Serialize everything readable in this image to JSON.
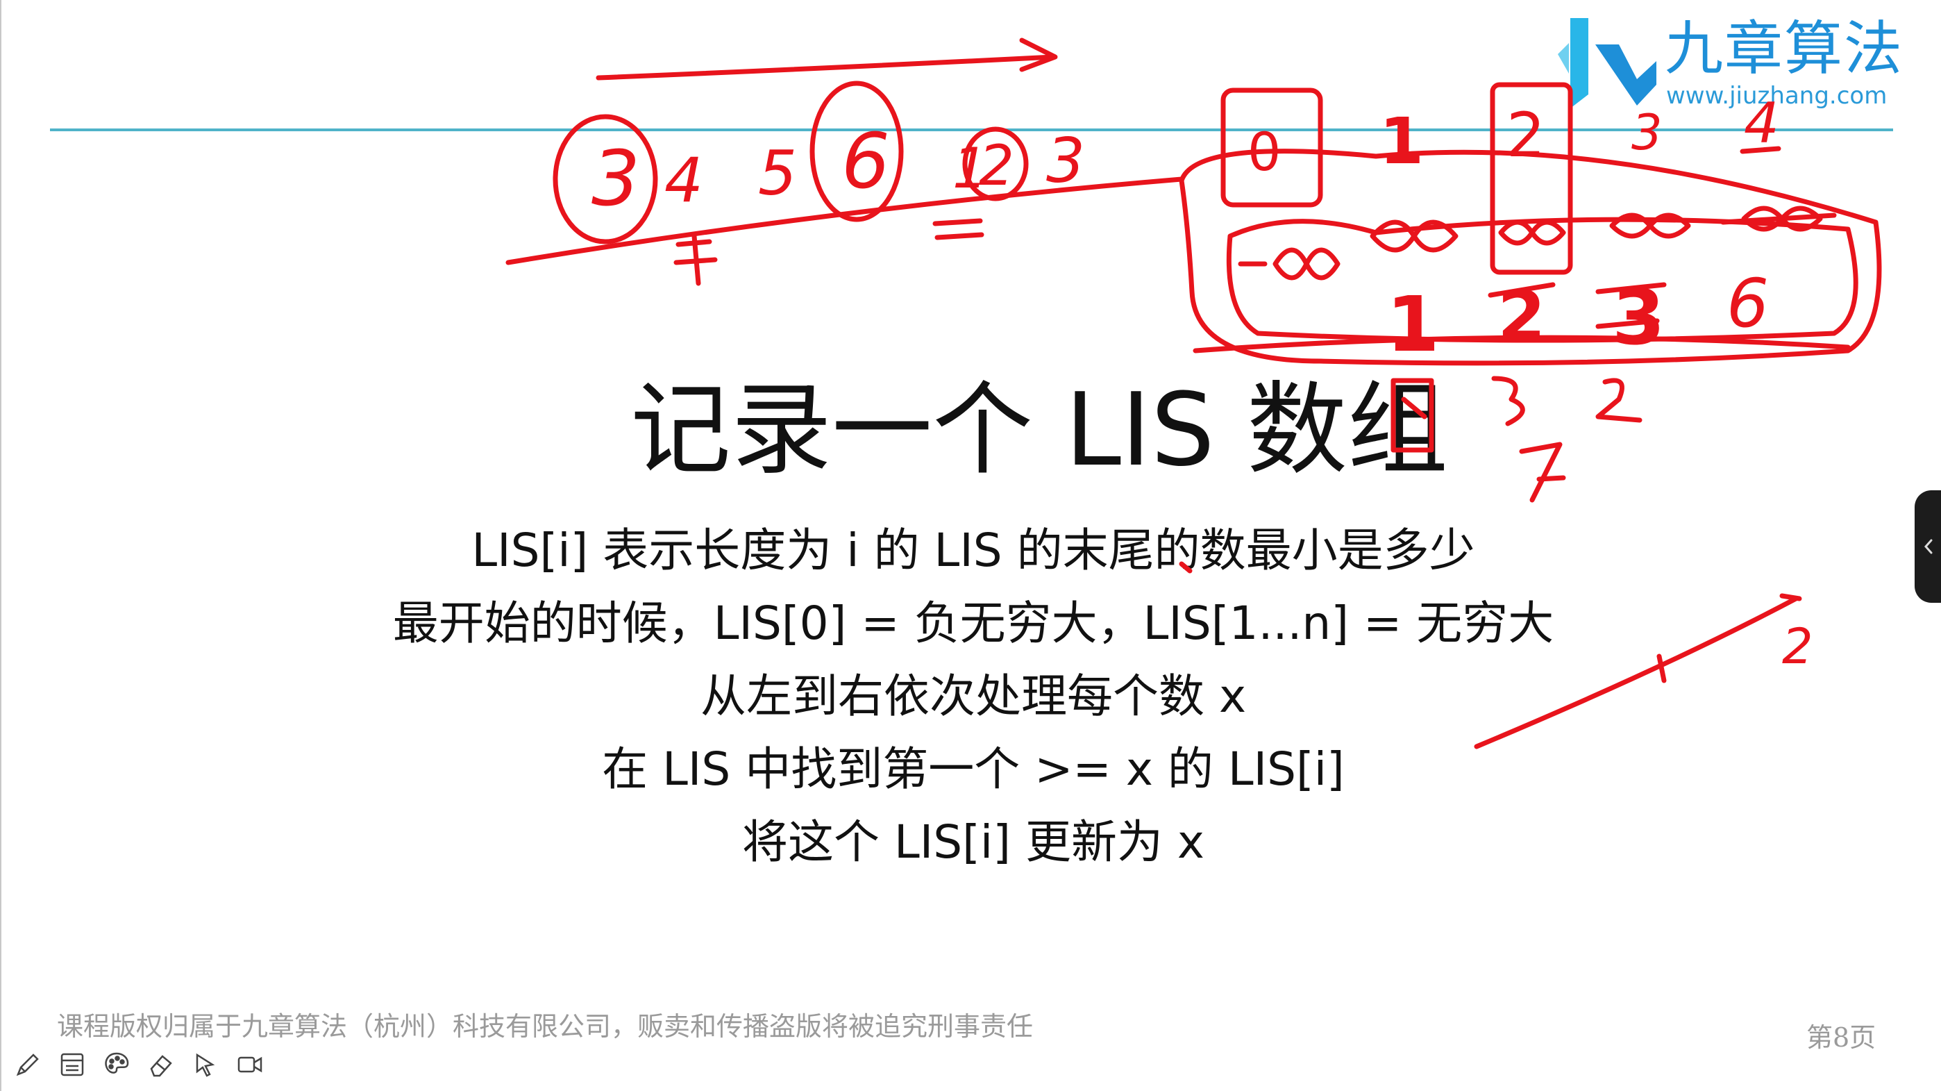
{
  "logo": {
    "name": "九章算法",
    "url": "www.jiuzhang.com",
    "color": "#1e8fd8"
  },
  "slide": {
    "title": "记录一个 LIS 数组",
    "bullets": [
      "LIS[i] 表示长度为 i 的 LIS 的末尾的数最小是多少",
      "最开始的时候，LIS[0] = 负无穷大，LIS[1...n] = 无穷大",
      "从左到右依次处理每个数 x",
      "在 LIS 中找到第一个 >= x 的 LIS[i]",
      "将这个 LIS[i] 更新为 x"
    ]
  },
  "footer": {
    "copyright": "课程版权归属于九章算法（杭州）科技有限公司，贩卖和传播盗版将被追究刑事责任",
    "page_number": "第8页"
  },
  "toolbar": {
    "tools": [
      "pencil-icon",
      "whiteboard-icon",
      "palette-icon",
      "eraser-icon",
      "pointer-icon",
      "video-camera-icon"
    ]
  },
  "side_panel": {
    "icon": "chevron-left-icon"
  },
  "annotations": {
    "ink_color": "#e8141c",
    "sequence": [
      "3",
      "4",
      "5",
      "6",
      "1",
      "2",
      "3"
    ],
    "index_labels": [
      "0",
      "1",
      "2",
      "3",
      "4"
    ],
    "array_values": [
      "6",
      "1",
      "2",
      "3"
    ],
    "extra_marks": [
      "1",
      "2"
    ]
  }
}
